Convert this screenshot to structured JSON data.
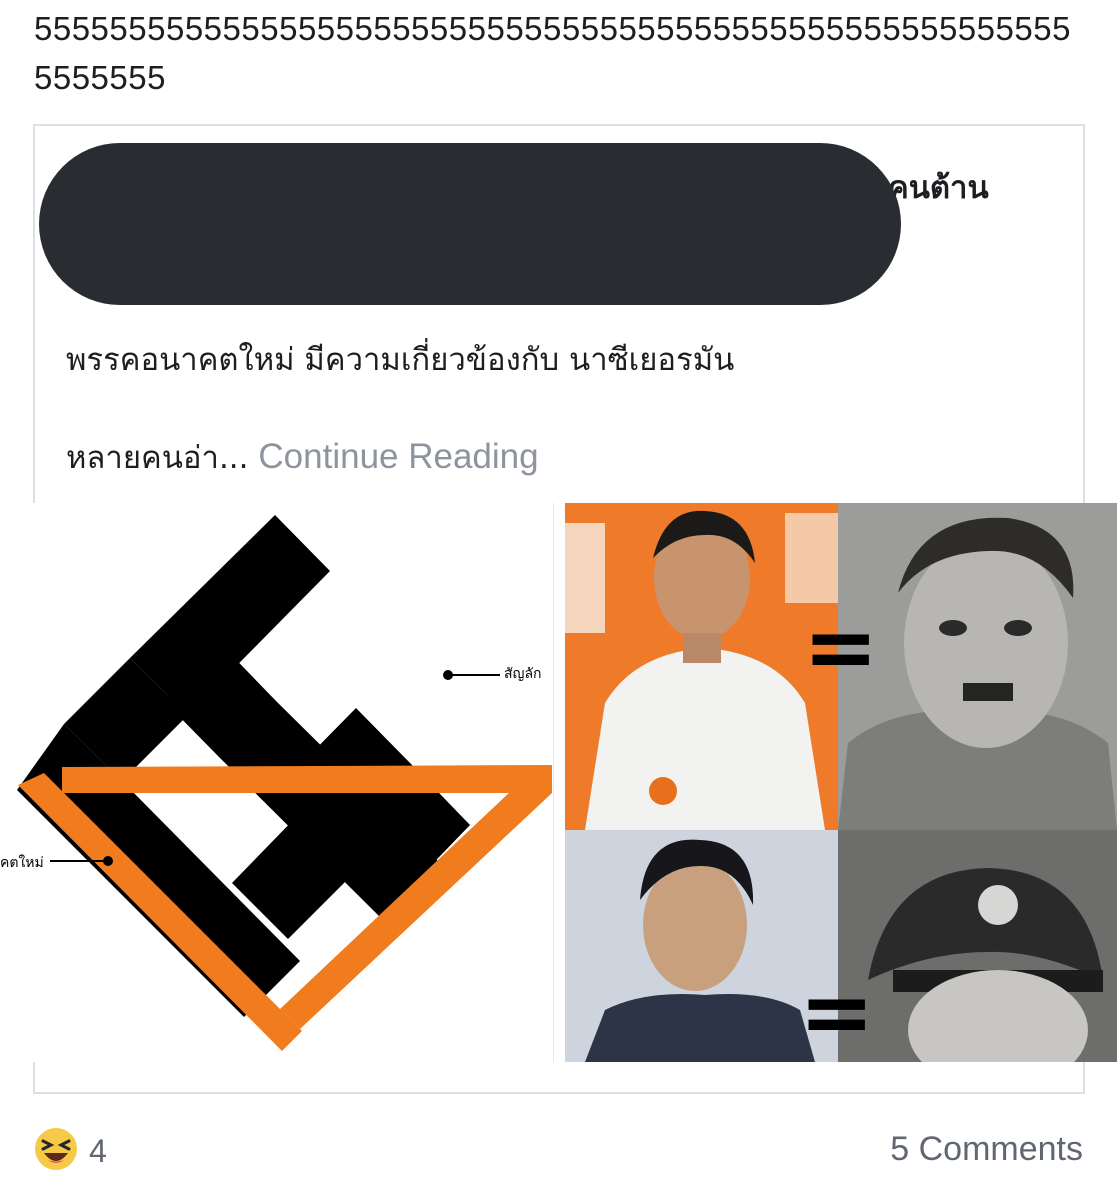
{
  "post": {
    "text": "55555555555555555555555555555555555555555555555555555555555555"
  },
  "shared": {
    "title_visible_fragment": "คนต้าน",
    "line1": "พรรคอนาคตใหม่ มีความเกี่ยวข้องกับ นาซีเยอรมัน",
    "line2_text": "หลายคนอ่า...",
    "continue_label": "Continue Reading",
    "image_left": {
      "label_right": "สัญลัก",
      "label_left": "คตใหม่"
    },
    "image_grid": {
      "equals_sign": "="
    }
  },
  "footer": {
    "reaction_icon": "laughing-emoji-icon",
    "reaction_count": "4",
    "comments_label": "5 Comments"
  },
  "colors": {
    "orange": "#f07c1e",
    "redaction": "#292c31",
    "muted_text": "#8d949e",
    "border": "#dddfe2"
  }
}
